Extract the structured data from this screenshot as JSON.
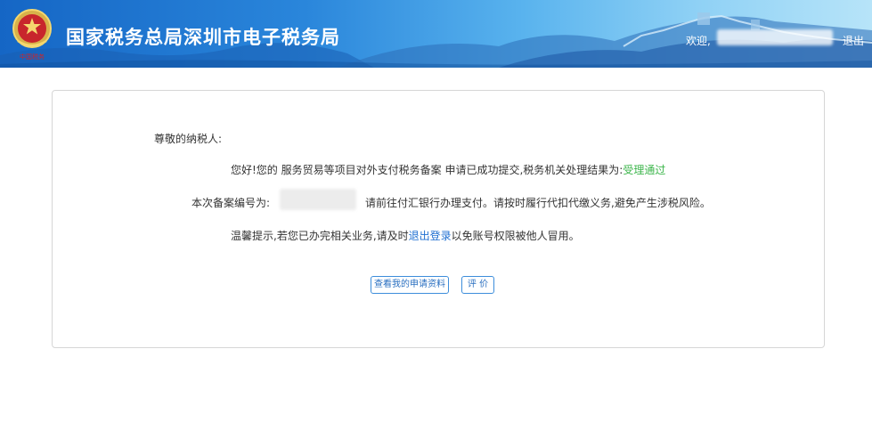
{
  "header": {
    "site_title": "国家税务总局深圳市电子税务局",
    "welcome_prefix": "欢迎,",
    "logout_label": "退出",
    "colors": {
      "banner_start": "#1566c5",
      "banner_end": "#b7e4f9"
    }
  },
  "emblem": {
    "icon": "tax-emblem-icon",
    "caption": "中国税务"
  },
  "notice": {
    "salutation": "尊敬的纳税人:",
    "line1_prefix": "您好!您的 服务贸易等项目对外支付税务备案 申请已成功提交,税务机关处理结果为:",
    "line1_status": "受理通过",
    "line2_prefix": "本次备案编号为:",
    "line2_suffix": "请前往付汇银行办理支付。请按时履行代扣代缴义务,避免产生涉税风险。",
    "line3_prefix": "温馨提示,若您已办完相关业务,请及时",
    "line3_link": "退出登录",
    "line3_suffix": "以免账号权限被他人冒用。",
    "status_color": "#3bb54a",
    "link_color": "#1f6fd1"
  },
  "actions": {
    "view_materials_label": "查看我的申请资料",
    "rate_label": "评 价"
  }
}
